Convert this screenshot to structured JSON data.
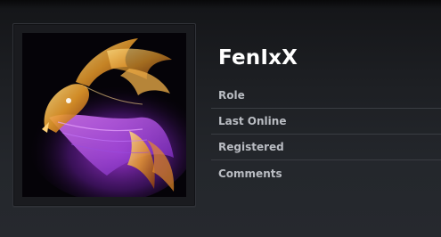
{
  "profile": {
    "username": "FenIxX",
    "avatar_icon": "phoenix-avatar",
    "fields": [
      {
        "label": "Role"
      },
      {
        "label": "Last Online"
      },
      {
        "label": "Registered"
      },
      {
        "label": "Comments"
      }
    ]
  },
  "colors": {
    "background": "#1d1f23",
    "username_text": "#ffffff",
    "field_label_text": "#b9bcc2",
    "divider": "#3a3d43",
    "avatar_purple": "#c23cff",
    "avatar_gold": "#f0b040"
  }
}
